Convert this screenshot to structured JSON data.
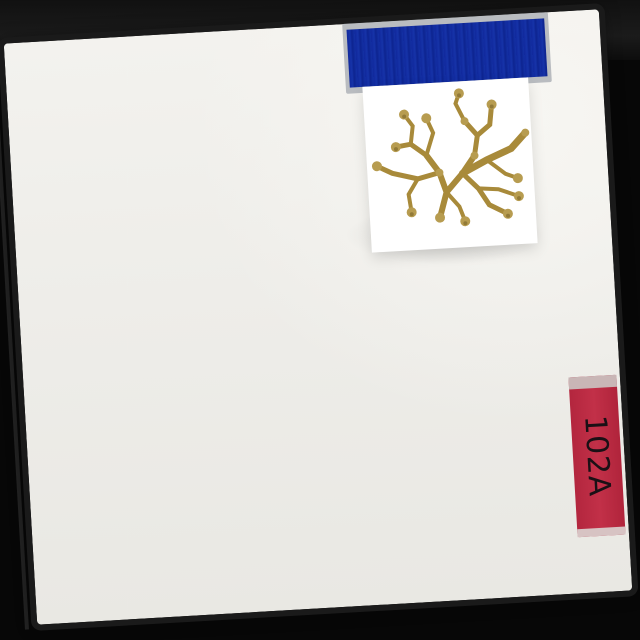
{
  "label": {
    "text": "102A",
    "color": "#c23048"
  },
  "tape": {
    "color": "#1633a8"
  },
  "specimen": {
    "icon": "coral-specimen-icon",
    "color": "#b49a4a"
  },
  "background": {
    "panel_color": "#f0efeb",
    "frame_color": "#070707"
  }
}
